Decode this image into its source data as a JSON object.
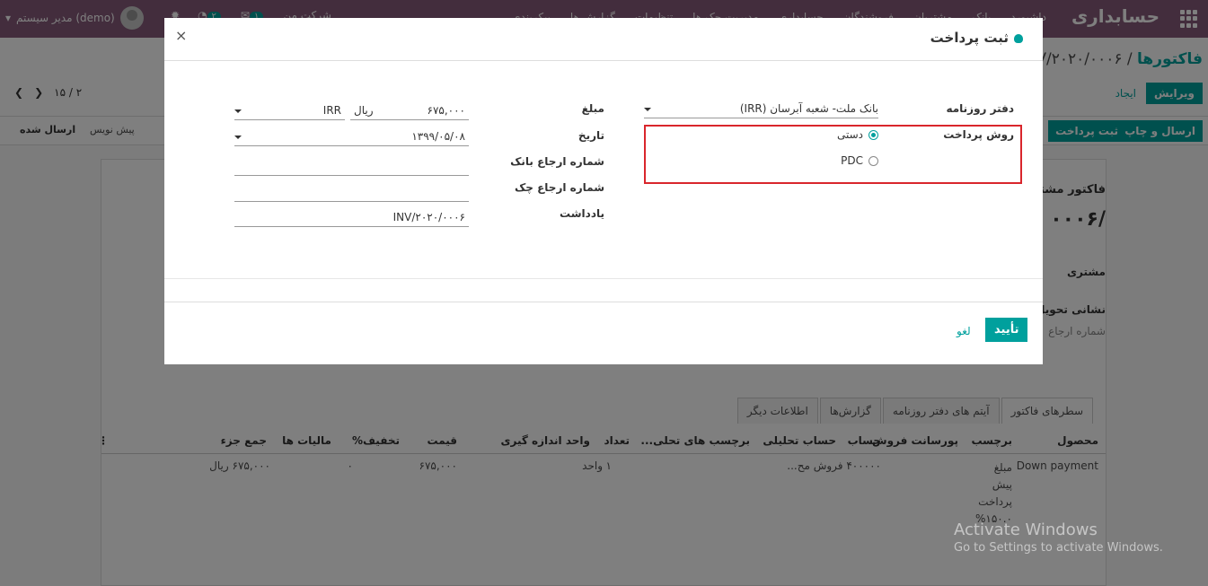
{
  "navbar": {
    "app_title": "حسابداری",
    "menu": [
      "داشبورد",
      "بانک",
      "مشتریان",
      "فروشندگان",
      "حسابداری",
      "مدیریت چک ها",
      "تنظیمات",
      "گزارش ها",
      "پیکربندی"
    ],
    "user": "مدیر سیستم (demo)",
    "company": "شرکت من",
    "badge_messages": "۱",
    "badge_activities": "۲"
  },
  "control": {
    "breadcrumb_parent": "فاکتورها",
    "breadcrumb_sep": "/",
    "breadcrumb_current": "INV/۲۰۲۰/۰۰۰۶",
    "edit_label": "ویرایش",
    "create_label": "ایجاد",
    "pager": "۱۵ / ۲"
  },
  "status_bar": {
    "send_print": "ارسال و چاپ",
    "register_payment": "ثبت پرداخت",
    "stage_draft": "پیش نویس",
    "stage_posted": "ارسال شده"
  },
  "sheet": {
    "invoice_type": "فاکتور مشتری",
    "invoice_number": "/۰۰۰۶",
    "customer_label": "مشتری",
    "delivery_label": "نشانی تحویل",
    "ref_label": "شماره ارجاع",
    "tabs": [
      "سطرهای فاکتور",
      "آیتم های دفتر روزنامه",
      "گزارش‌ها",
      "اطلاعات دیگر"
    ],
    "columns": [
      "محصول",
      "برچسب",
      "پورسانت فروش",
      "حساب",
      "حساب تحلیلی",
      "برچسب های تحلی...",
      "تعداد",
      "واحد اندازه گیری",
      "قیمت",
      "تخفیف%",
      "مالیات ها",
      "جمع جزء"
    ],
    "row": {
      "product": "Down payment",
      "label_lines": [
        "مبلغ",
        "پیش",
        "پرداخت",
        "%۱۵۰.۰"
      ],
      "account": "۴۰۰۰۰۰ فروش مح...",
      "qty": "۱",
      "uom": "واحد",
      "price": "۶۷۵,۰۰۰",
      "discount": "۰",
      "subtotal": "۶۷۵,۰۰۰ ریال"
    }
  },
  "modal": {
    "title": "ثبت پرداخت",
    "journal_label": "دفتر روزنامه",
    "journal_value": "بانک ملت- شعبه آبرسان (IRR)",
    "method_label": "روش پرداخت",
    "method_options": [
      "دستی",
      "PDC"
    ],
    "amount_label": "مبلغ",
    "amount_value": "۶۷۵,۰۰۰",
    "currency_symbol": "ریال",
    "currency_code": "IRR",
    "date_label": "تاریخ",
    "date_value": "۱۳۹۹/۰۵/۰۸",
    "bank_ref_label": "شماره ارجاع بانک",
    "check_ref_label": "شماره ارجاع چک",
    "memo_label": "یادداشت",
    "memo_value": "INV/۲۰۲۰/۰۰۰۶",
    "confirm_label": "تأیید",
    "cancel_label": "لغو",
    "close_glyph": "×"
  },
  "watermark": {
    "line1": "Activate Windows",
    "line2": "Go to Settings to activate Windows."
  }
}
